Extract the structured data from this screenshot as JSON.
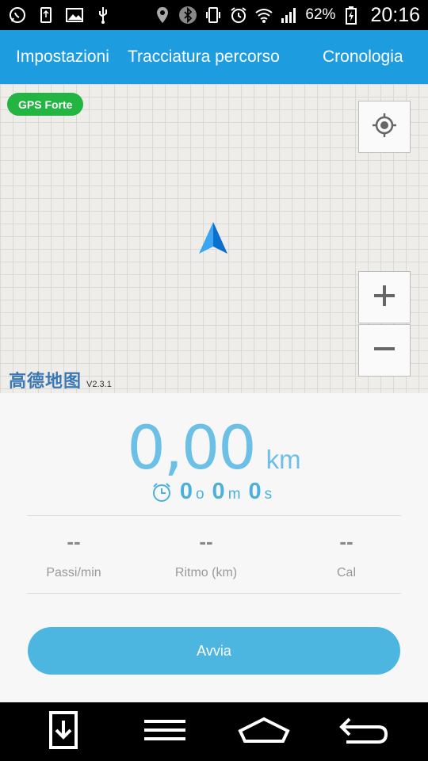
{
  "status_bar": {
    "battery_percent": "62%",
    "time": "20:16",
    "icons": [
      "whatsapp-icon",
      "usb-icon",
      "image-icon",
      "usb-debug-icon",
      "location-icon",
      "bluetooth-icon",
      "vibrate-icon",
      "alarm-icon",
      "wifi-icon",
      "signal-icon",
      "battery-charging-icon"
    ]
  },
  "header": {
    "tabs": [
      {
        "label": "Impostazioni"
      },
      {
        "label": "Tracciatura percorso"
      },
      {
        "label": "Cronologia"
      }
    ],
    "background_color": "#1e9ce0"
  },
  "map": {
    "gps_status": "GPS  Forte",
    "gps_status_color": "#22b541",
    "logo_text": "高德地图",
    "version": "V2.3.1"
  },
  "workout": {
    "distance_value": "0,00",
    "distance_unit": "km",
    "duration": {
      "hours": "0",
      "hours_unit": "o",
      "minutes": "0",
      "minutes_unit": "m",
      "seconds": "0",
      "seconds_unit": "s"
    },
    "metrics": [
      {
        "value": "--",
        "label": "Passi/min"
      },
      {
        "value": "--",
        "label": "Ritmo (km)"
      },
      {
        "value": "--",
        "label": "Cal"
      }
    ],
    "start_button_label": "Avvia",
    "accent_color": "#4db6e0"
  },
  "nav_bar": {
    "icons": [
      "download-icon",
      "menu-icon",
      "home-icon",
      "back-icon"
    ]
  }
}
